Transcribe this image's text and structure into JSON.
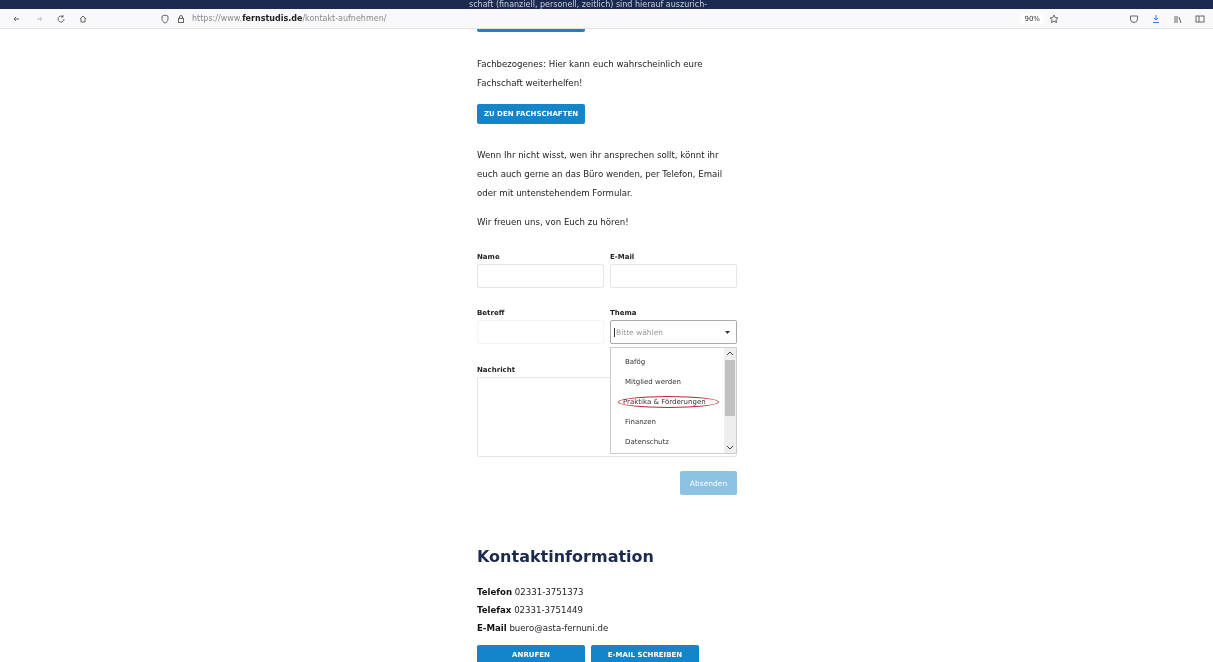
{
  "top_strip": {
    "text": "schaft (finanziell, personell, zeitlich) sind hierauf auszurich-"
  },
  "toolbar": {
    "url": "https://www.**fernstudis.de**/kontakt-aufnehmen/",
    "zoom": "90%"
  },
  "intro": [
    {
      "kind": "text",
      "text": "Fachbezogenes: Hier kann euch wahrscheinlich eure Fachschaft weiterhelfen!"
    },
    {
      "kind": "button",
      "text": "ZU DEN FACHSCHAFTEN"
    },
    {
      "kind": "text",
      "text": "Wenn Ihr nicht wisst, wen ihr ansprechen sollt, könnt ihr euch auch gerne an das Büro wenden, per Telefon, Email oder mit untenstehendem Formular."
    },
    {
      "kind": "text",
      "text": "Wir freuen uns, von Euch zu hören!"
    }
  ],
  "form": {
    "name_label": "Name",
    "email_label": "E-Mail",
    "subject_label": "Betreff",
    "topic_label": "Thema",
    "topic_placeholder": "Bitte wählen",
    "message_label": "Nachricht",
    "topic_expanded": true,
    "topic_options": [
      {
        "label": "Bafög",
        "circled": false
      },
      {
        "label": "Mitglied werden",
        "circled": false
      },
      {
        "label": "Praktika & Förderungen",
        "circled": true
      },
      {
        "label": "Finanzen",
        "circled": false
      },
      {
        "label": "Datenschutz",
        "circled": false
      }
    ],
    "submit": {
      "label": "Absenden",
      "disabled": true
    }
  },
  "contact": {
    "title": "Kontaktinformation",
    "lines": [
      {
        "label": "Telefon",
        "value": "02331-3751373"
      },
      {
        "label": "Telefax",
        "value": "02331-3751449"
      },
      {
        "label": "E-Mail",
        "value": "buero@asta-fernuni.de"
      }
    ],
    "buttons": [
      "ANRUFEN",
      "E-MAIL SCHREIBEN"
    ]
  }
}
